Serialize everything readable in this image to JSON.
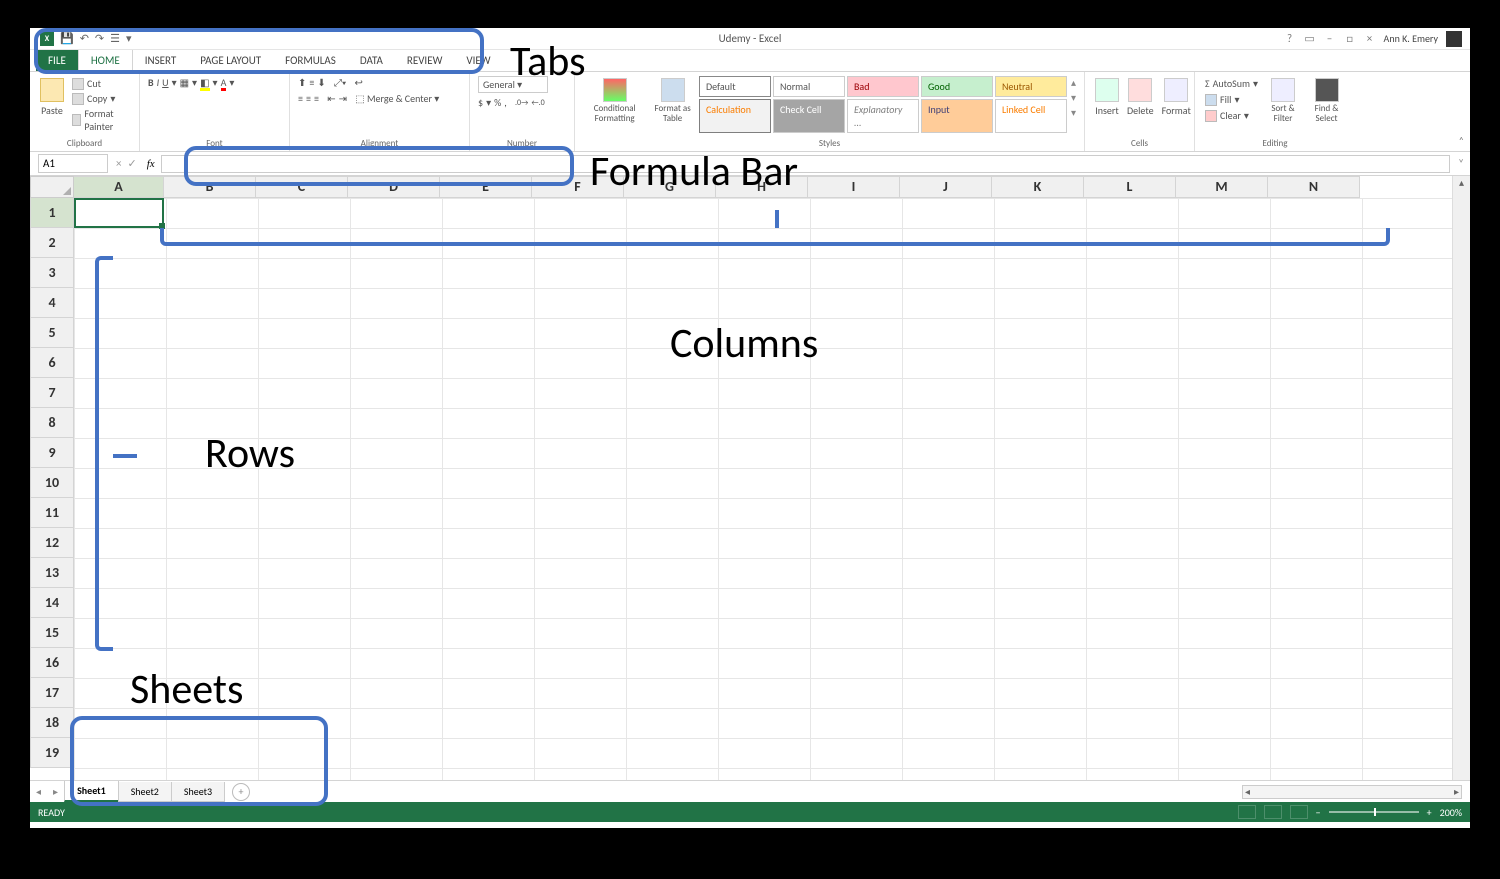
{
  "app": {
    "title": "Udemy - Excel"
  },
  "user": {
    "name": "Ann K. Emery"
  },
  "qat": {
    "icons": [
      "save-icon",
      "undo-icon",
      "redo-icon",
      "touch-mode-icon",
      "customize-icon"
    ]
  },
  "window_controls": {
    "help": "?",
    "ribbon_opts": "▭",
    "minimize": "–",
    "restore": "□",
    "close": "×"
  },
  "tabs": {
    "file": "FILE",
    "items": [
      "HOME",
      "INSERT",
      "PAGE LAYOUT",
      "FORMULAS",
      "DATA",
      "REVIEW",
      "VIEW"
    ],
    "active": "HOME"
  },
  "ribbon": {
    "clipboard": {
      "label": "Clipboard",
      "paste": "Paste",
      "cut": "Cut",
      "copy": "Copy",
      "painter": "Format Painter"
    },
    "font": {
      "label": "Font"
    },
    "alignment": {
      "label": "Alignment",
      "merge": "Merge & Center"
    },
    "number": {
      "label": "Number",
      "format": "General",
      "currency": "$",
      "percent": "%",
      "comma": ",",
      "inc": ".0→.00",
      "dec": ".00→.0"
    },
    "styles": {
      "label": "Styles",
      "cond": "Conditional Formatting",
      "table": "Format as Table",
      "cells": {
        "default": "Default",
        "normal": "Normal",
        "bad": "Bad",
        "good": "Good",
        "neutral": "Neutral",
        "calculation": "Calculation",
        "check": "Check Cell",
        "explanatory": "Explanatory ...",
        "input": "Input",
        "linked": "Linked Cell"
      }
    },
    "cells_group": {
      "label": "Cells",
      "insert": "Insert",
      "delete": "Delete",
      "format": "Format"
    },
    "editing": {
      "label": "Editing",
      "autosum": "AutoSum",
      "fill": "Fill",
      "clear": "Clear",
      "sort": "Sort & Filter",
      "find": "Find & Select"
    }
  },
  "formula_bar": {
    "name_box": "A1",
    "fx": "fx",
    "value": ""
  },
  "grid": {
    "columns": [
      "A",
      "B",
      "C",
      "D",
      "E",
      "F",
      "G",
      "H",
      "I",
      "J",
      "K",
      "L",
      "M",
      "N"
    ],
    "rows": [
      "1",
      "2",
      "3",
      "4",
      "5",
      "6",
      "7",
      "8",
      "9",
      "10",
      "11",
      "12",
      "13",
      "14",
      "15",
      "16",
      "17",
      "18",
      "19"
    ],
    "active_cell": "A1"
  },
  "sheets": {
    "items": [
      "Sheet1",
      "Sheet2",
      "Sheet3"
    ],
    "active": "Sheet1"
  },
  "status": {
    "ready": "READY",
    "zoom": "200%"
  },
  "annotations": {
    "tabs": "Tabs",
    "formula_bar": "Formula Bar",
    "columns": "Columns",
    "rows": "Rows",
    "sheets": "Sheets"
  }
}
